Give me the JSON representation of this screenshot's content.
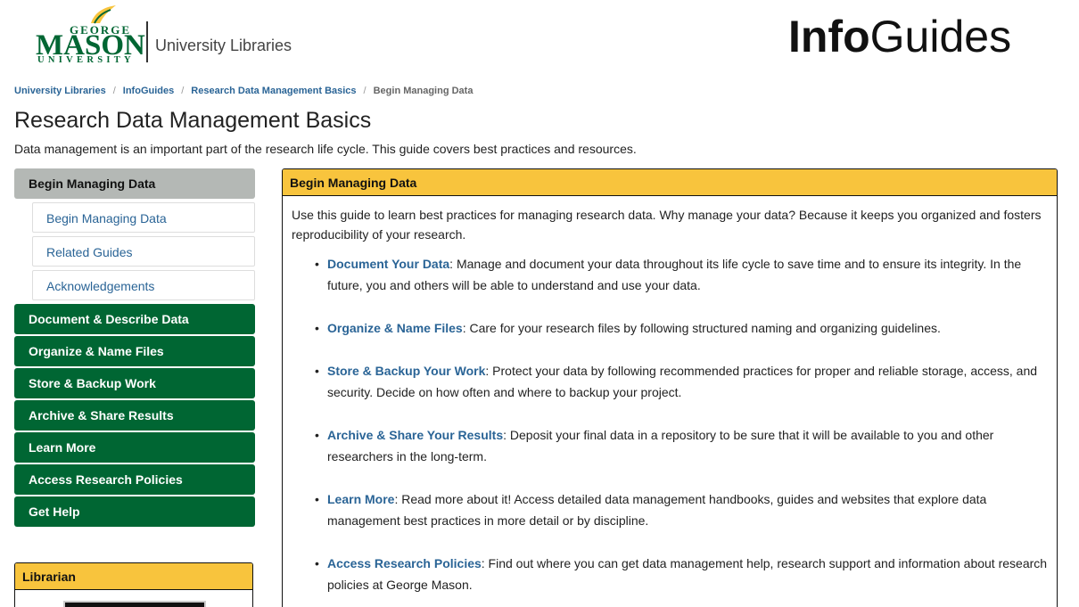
{
  "header": {
    "logo_top": "GEORGE",
    "logo_main": "MASON",
    "logo_bottom": "UNIVERSITY",
    "library_name": "University Libraries",
    "site_title_bold": "Info",
    "site_title_rest": "Guides"
  },
  "breadcrumb": [
    {
      "label": "University Libraries"
    },
    {
      "label": "InfoGuides"
    },
    {
      "label": "Research Data Management Basics"
    },
    {
      "label": "Begin Managing Data"
    }
  ],
  "breadcrumb_separator": "/",
  "page": {
    "title": "Research Data Management Basics",
    "description": "Data management is an important part of the research life cycle. This guide covers best practices and resources."
  },
  "sidenav": {
    "active": "Begin Managing Data",
    "subitems": [
      "Begin Managing Data",
      "Related Guides",
      "Acknowledgements"
    ],
    "items": [
      "Document & Describe Data",
      "Organize & Name Files",
      "Store & Backup Work",
      "Archive & Share Results",
      "Learn More",
      "Access Research Policies",
      "Get Help"
    ]
  },
  "librarian": {
    "title": "Librarian"
  },
  "main": {
    "title": "Begin Managing Data",
    "intro": "Use this guide to learn best practices for managing research data. Why manage your data? Because it keeps you organized and fosters reproducibility of your research.",
    "bullets": [
      {
        "link": "Document Your Data",
        "text": ": Manage and document your data throughout its life cycle to save time and to ensure its integrity. In the future, you and others will be able to understand and use your data."
      },
      {
        "link": "Organize & Name Files",
        "text": ": Care for your research files by following structured naming and organizing guidelines."
      },
      {
        "link": "Store & Backup Your Work",
        "text": ": Protect your data by following recommended practices for proper and reliable storage, access, and security. Decide on how often and where to backup your project."
      },
      {
        "link": "Archive & Share Your Results",
        "text": ": Deposit your final data in a repository to be sure that it will be available to you and other researchers in the long-term."
      },
      {
        "link": "Learn More",
        "text": ": Read more about it! Access detailed data management handbooks, guides and websites that explore data management best practices in more detail or by discipline."
      },
      {
        "link": "Access Research Policies",
        "text": ": Find out where you can get data management help, research support and information about research policies at George Mason."
      }
    ]
  },
  "colors": {
    "gmu_green": "#006633",
    "gold": "#f8c43d",
    "link_blue": "#2a6496"
  }
}
